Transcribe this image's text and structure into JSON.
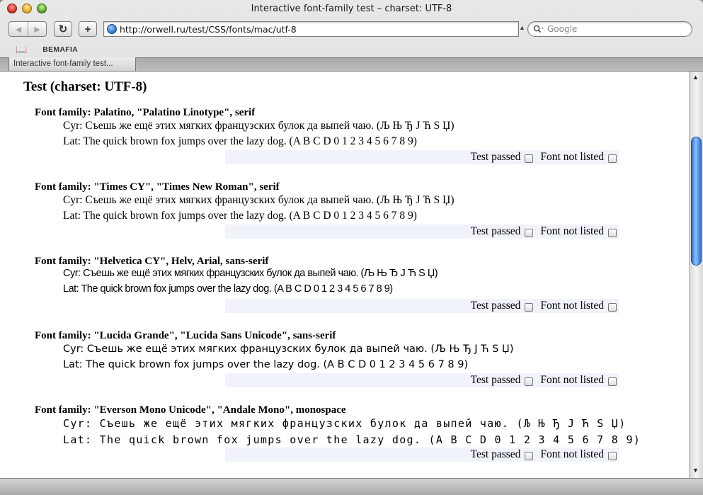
{
  "window": {
    "title": "Interactive font-family test – charset: UTF-8"
  },
  "toolbar": {
    "back_glyph": "◀",
    "forward_glyph": "▶",
    "reload_glyph": "↻",
    "add_glyph": "+",
    "url": "http://orwell.ru/test/CSS/fonts/mac/utf-8",
    "search_placeholder": "Google"
  },
  "bookmarks": {
    "items": [
      {
        "label": "BEMAFIA"
      }
    ]
  },
  "tabs": [
    {
      "label": "Interactive font-family test..."
    }
  ],
  "page": {
    "heading": "Test (charset: UTF-8)",
    "tests": [
      {
        "heading": "Font family: Palatino, \"Palatino Linotype\", serif",
        "cyr": "Cyr: Съешь же ещё этих мягких французских булок да выпей чаю. (Љ Њ Ђ Ј Ћ Ѕ Џ)",
        "lat": "Lat: The quick brown fox jumps over the lazy dog. (A B C D 0 1 2 3 4 5 6 7 8 9)",
        "passed_label": "Test passed",
        "not_listed_label": "Font not listed"
      },
      {
        "heading": "Font family: \"Times CY\", \"Times New Roman\", serif",
        "cyr": "Cyr: Съешь же ещё этих мягких французских булок да выпей чаю. (Љ Њ Ђ Ј Ћ Ѕ Џ)",
        "lat": "Lat: The quick brown fox jumps over the lazy dog. (A B C D 0 1 2 3 4 5 6 7 8 9)",
        "passed_label": "Test passed",
        "not_listed_label": "Font not listed"
      },
      {
        "heading": "Font family: \"Helvetica CY\", Helv, Arial, sans-serif",
        "cyr": "Cyr: Съешь же ещё этих мягких французских булок да выпей чаю. (Љ Њ Ђ Ј Ћ Ѕ Џ)",
        "lat": "Lat: The quick brown fox jumps over the lazy dog. (A B C D 0 1 2 3 4 5 6 7 8 9)",
        "passed_label": "Test passed",
        "not_listed_label": "Font not listed"
      },
      {
        "heading": "Font family: \"Lucida Grande\", \"Lucida Sans Unicode\", sans-serif",
        "cyr": "Cyr: Съешь же ещё этих мягких французских булок да выпей чаю. (Љ Њ Ђ Ј Ћ Ѕ Џ)",
        "lat": "Lat: The quick brown fox jumps over the lazy dog. (A B C D 0 1 2 3 4 5 6 7 8 9)",
        "passed_label": "Test passed",
        "not_listed_label": "Font not listed"
      },
      {
        "heading": "Font family: \"Everson Mono Unicode\", \"Andale Mono\", monospace",
        "cyr": "Cyr: Съешь же ещё этих мягких французских булок да выпей чаю. (Љ Њ Ђ Ј Ћ Ѕ Џ)",
        "lat": "Lat: The quick brown fox jumps over the lazy dog. (A B C D 0 1 2 3 4 5 6 7 8 9)",
        "passed_label": "Test passed",
        "not_listed_label": "Font not listed"
      }
    ]
  },
  "icons": {
    "close": "close-icon",
    "minimize": "minimize-icon",
    "zoom": "zoom-icon",
    "globe": "globe-icon",
    "search": "magnifier-icon",
    "bookmarks": "open-book-icon"
  },
  "colors": {
    "result_row_bg": "#f1f3fb",
    "scroll_thumb": "#2f6fd1"
  }
}
